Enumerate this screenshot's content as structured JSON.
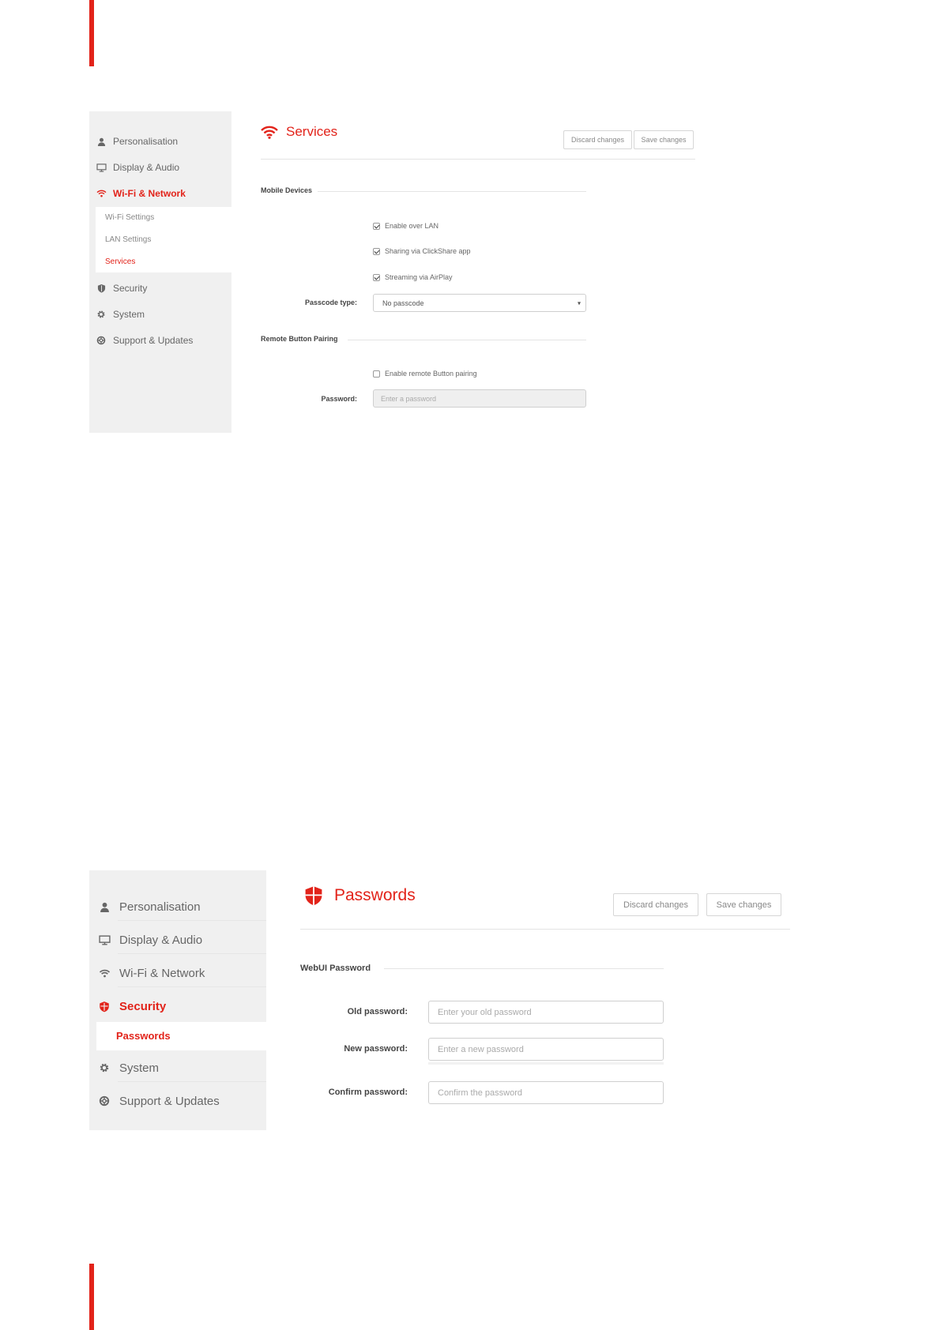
{
  "panel1": {
    "sidebar": {
      "items": [
        {
          "label": "Personalisation",
          "icon": "person-icon"
        },
        {
          "label": "Display & Audio",
          "icon": "monitor-icon"
        },
        {
          "label": "Wi-Fi & Network",
          "icon": "wifi-icon",
          "active": true
        },
        {
          "label": "Security",
          "icon": "shield-icon"
        },
        {
          "label": "System",
          "icon": "gear-icon"
        },
        {
          "label": "Support & Updates",
          "icon": "lifebuoy-icon"
        }
      ],
      "subitems": [
        {
          "label": "Wi-Fi Settings"
        },
        {
          "label": "LAN Settings"
        },
        {
          "label": "Services",
          "active": true
        }
      ]
    },
    "title": "Services",
    "buttons": {
      "discard": "Discard changes",
      "save": "Save changes"
    },
    "sections": {
      "mobile_devices": "Mobile Devices",
      "remote_button": "Remote Button Pairing"
    },
    "checks": {
      "enable_lan": {
        "label": "Enable over LAN",
        "checked": true
      },
      "clickshare_app": {
        "label": "Sharing via ClickShare app",
        "checked": true
      },
      "airplay": {
        "label": "Streaming via AirPlay",
        "checked": true
      },
      "remote_pairing": {
        "label": "Enable remote Button pairing",
        "checked": false
      }
    },
    "passcode": {
      "label": "Passcode type:",
      "value": "No passcode"
    },
    "password": {
      "label": "Password:",
      "placeholder": "Enter a password"
    }
  },
  "panel2": {
    "sidebar": {
      "items": [
        {
          "label": "Personalisation",
          "icon": "person-icon"
        },
        {
          "label": "Display & Audio",
          "icon": "monitor-icon"
        },
        {
          "label": "Wi-Fi & Network",
          "icon": "wifi-icon"
        },
        {
          "label": "Security",
          "icon": "shield-icon",
          "active": true
        },
        {
          "label": "System",
          "icon": "gear-icon"
        },
        {
          "label": "Support & Updates",
          "icon": "lifebuoy-icon"
        }
      ],
      "subitems": [
        {
          "label": "Passwords",
          "active": true
        }
      ]
    },
    "title": "Passwords",
    "buttons": {
      "discard": "Discard changes",
      "save": "Save changes"
    },
    "section": "WebUI Password",
    "fields": {
      "old": {
        "label": "Old password:",
        "placeholder": "Enter your old password"
      },
      "new": {
        "label": "New password:",
        "placeholder": "Enter a new password"
      },
      "confirm": {
        "label": "Confirm password:",
        "placeholder": "Confirm the password"
      }
    }
  },
  "colors": {
    "accent": "#e2231a",
    "sidebar_bg": "#f0f0f0"
  }
}
